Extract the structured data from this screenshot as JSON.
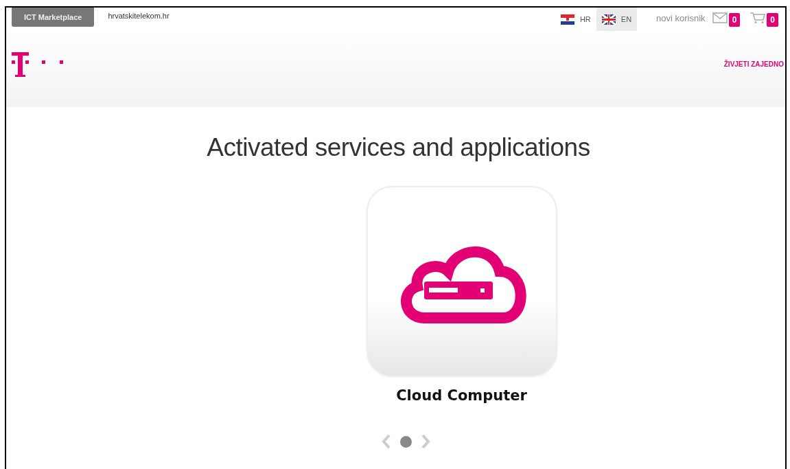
{
  "top_bar": {
    "marketplace_button": "ICT Marketplace",
    "site_link": "hrvatskitelekom.hr",
    "languages": [
      {
        "code": "HR",
        "kind": "hr",
        "selected": false
      },
      {
        "code": "EN",
        "kind": "en",
        "selected": true
      }
    ],
    "user": "novi korisnik",
    "messages_count": "0",
    "cart_count": "0"
  },
  "header": {
    "slogan": "ŽIVJETI ZAJEDNO"
  },
  "title": "Activated services and applications",
  "apps": [
    {
      "name": "Cloud Computer"
    }
  ],
  "pager": {
    "dots": [
      {
        "selected": true
      }
    ]
  }
}
